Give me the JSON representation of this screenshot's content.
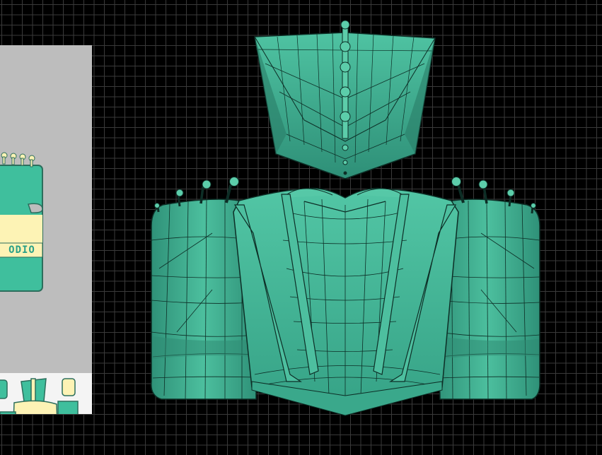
{
  "reference": {
    "texture_label": "ODIO"
  },
  "colors": {
    "mesh_fill": "#3fb596",
    "mesh_light": "#5ccdaa",
    "mesh_dark": "#1f6e5a",
    "wire": "#0d2e26",
    "grid": "#3a3a3a",
    "background": "#000000",
    "ref_panel": "#bdbdbd",
    "ref_yellow": "#fdf3b5"
  },
  "objects": [
    {
      "name": "head-piece"
    },
    {
      "name": "left-shoulder-pad"
    },
    {
      "name": "torso-armor"
    },
    {
      "name": "right-shoulder-pad"
    }
  ]
}
